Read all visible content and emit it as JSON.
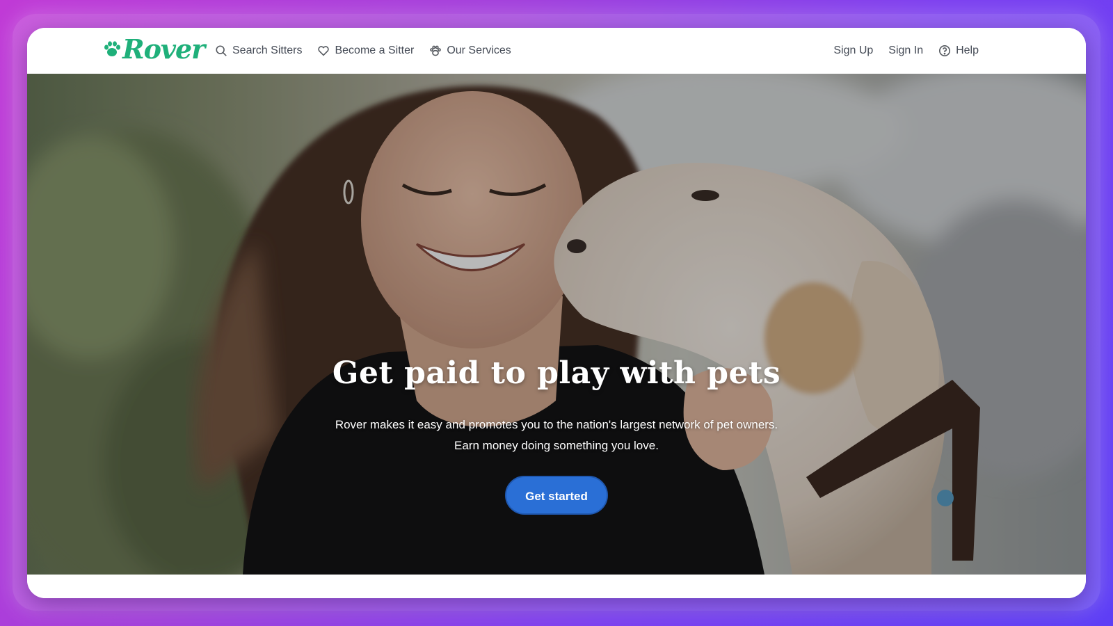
{
  "brand": {
    "name": "Rover",
    "color": "#1fb07a"
  },
  "nav": {
    "left": [
      {
        "label": "Search Sitters",
        "icon": "search-icon"
      },
      {
        "label": "Become a Sitter",
        "icon": "heart-icon"
      },
      {
        "label": "Our Services",
        "icon": "paw-icon"
      }
    ],
    "right": [
      {
        "label": "Sign Up"
      },
      {
        "label": "Sign In"
      },
      {
        "label": "Help",
        "icon": "help-circle-icon"
      }
    ]
  },
  "hero": {
    "title": "Get paid to play with pets",
    "subtitle_line1": "Rover makes it easy and promotes you to the nation's largest network of pet owners.",
    "subtitle_line2": "Earn money doing something you love.",
    "cta_label": "Get started",
    "cta_color": "#2a6fd6"
  }
}
